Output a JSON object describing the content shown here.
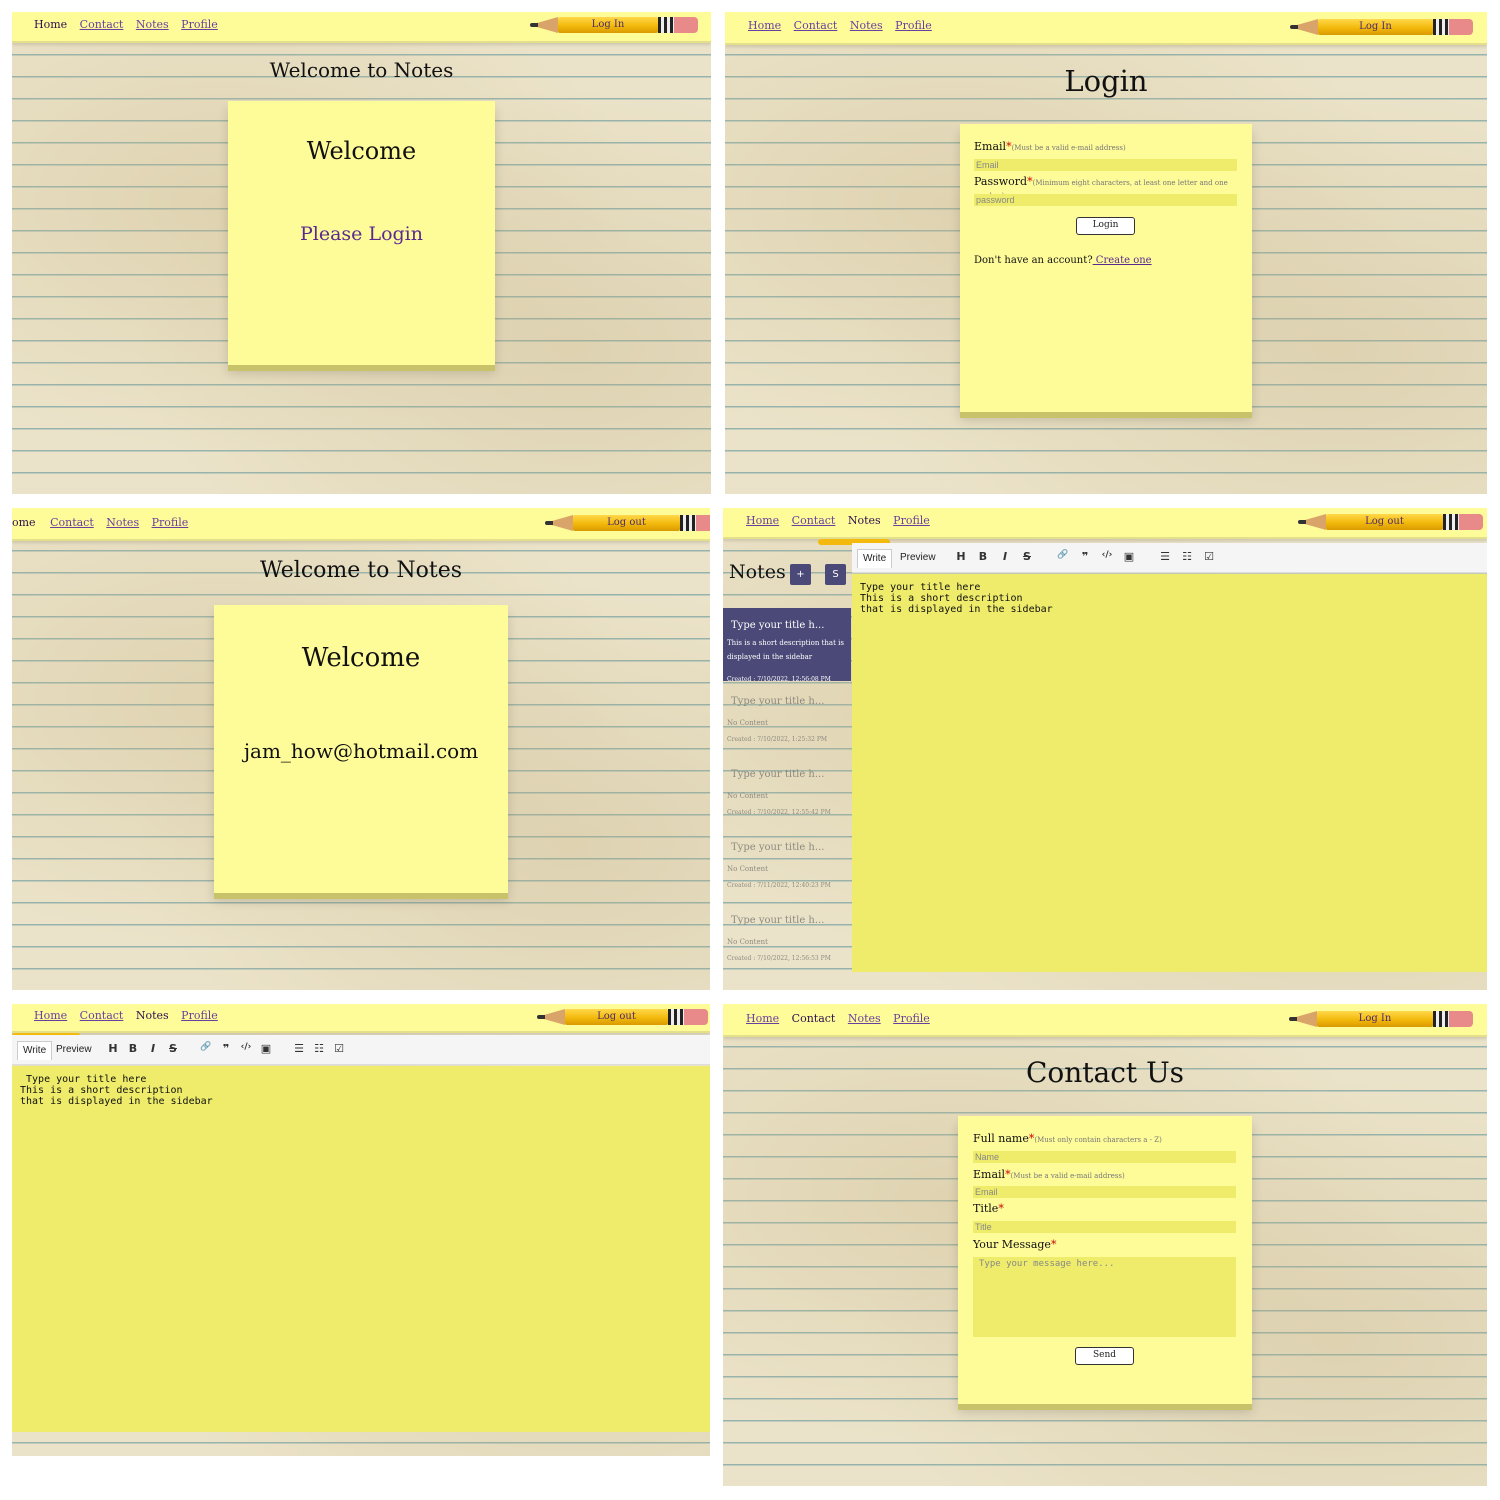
{
  "nav": {
    "home": "Home",
    "contact": "Contact",
    "notes": "Notes",
    "profile": "Profile",
    "login": "Log In",
    "logout": "Log out",
    "home_cut": "ome"
  },
  "home": {
    "title": "Welcome to Notes",
    "note_title": "Welcome",
    "note_link": "Please Login"
  },
  "login": {
    "title": "Login",
    "email_label": "Email",
    "email_hint": "(Must be a valid e-mail address)",
    "email_placeholder": "Email",
    "password_label": "Password",
    "password_hint": "(Minimum eight characters, at least one letter and one number)",
    "password_placeholder": "password",
    "button": "Login",
    "no_account": "Don't have an account?",
    "create": " Create one"
  },
  "home_logged": {
    "title": "Welcome to Notes",
    "note_title": "Welcome",
    "user": "jam_how@hotmail.com"
  },
  "notes": {
    "heading": "Notes",
    "add_btn": "+",
    "save_btn": "S",
    "toolbar": {
      "write": "Write",
      "preview": "Preview",
      "h": "H",
      "b": "B",
      "i": "I",
      "s": "S",
      "link": "🔗",
      "quote": "❞",
      "code": "‹/›",
      "image": "▣",
      "ul": "☰",
      "ol": "☷",
      "task": "☑"
    },
    "editor_text": "Type your title here\nThis is a short description\nthat is displayed in the sidebar",
    "items": [
      {
        "title": "Type your title h...",
        "desc": "This is a short description that is displayed in the sidebar",
        "created": "Created : 7/10/2022, 12:56:08 PM"
      },
      {
        "title": "Type your title h...",
        "desc": "No Content",
        "created": "Created : 7/10/2022, 1:25:32 PM"
      },
      {
        "title": "Type your title h...",
        "desc": "No Content",
        "created": "Created : 7/10/2022, 12:55:42 PM"
      },
      {
        "title": "Type your title h...",
        "desc": "No Content",
        "created": "Created : 7/11/2022, 12:40:23 PM"
      },
      {
        "title": "Type your title h...",
        "desc": "No Content",
        "created": "Created : 7/10/2022, 12:56:53 PM"
      }
    ]
  },
  "editor_only": {
    "editor_text": " Type your title here\nThis is a short description\nthat is displayed in the sidebar"
  },
  "contact": {
    "title": "Contact Us",
    "name_label": "Full name",
    "name_hint": "(Must only contain characters a - Z)",
    "name_placeholder": "Name",
    "email_label": "Email",
    "email_hint": "(Must be a valid e-mail address)",
    "email_placeholder": "Email",
    "title_label": "Title",
    "title_placeholder": "Title",
    "message_label": "Your Message",
    "message_placeholder": "Type your message here...",
    "send": "Send",
    "req": "*"
  }
}
